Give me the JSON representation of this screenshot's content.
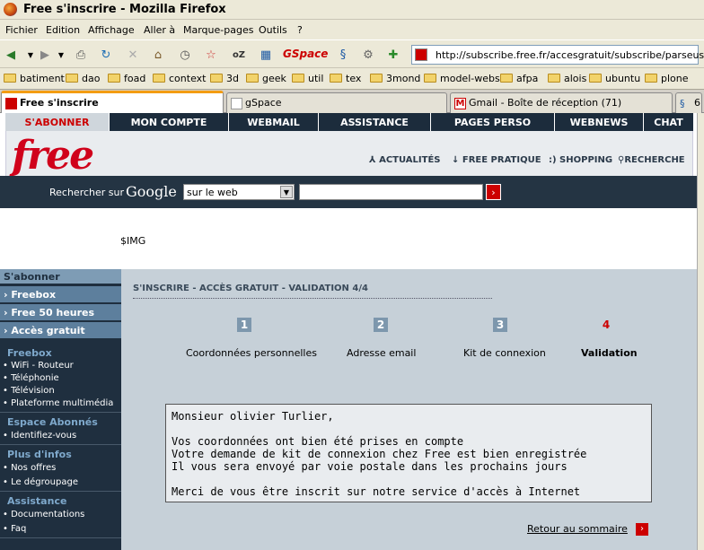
{
  "window": {
    "title": "Free s'inscrire - Mozilla Firefox"
  },
  "menu": [
    "Fichier",
    "Edition",
    "Affichage",
    "Aller à",
    "Marque-pages",
    "Outils",
    "?"
  ],
  "toolbar": {
    "gspace_label": "GSpace",
    "url": "http://subscribe.free.fr/accesgratuit/subscribe/parseuser.pl"
  },
  "bookmarks": [
    "batiment",
    "dao",
    "foad",
    "context",
    "3d",
    "geek",
    "util",
    "tex",
    "3mond",
    "model-webs",
    "afpa",
    "alois",
    "ubuntu",
    "plone"
  ],
  "tabs": [
    "Free s'inscrire",
    "gSpace",
    "Gmail - Boîte de réception (71)",
    "6"
  ],
  "free_nav": [
    "S'ABONNER",
    "MON COMPTE",
    "WEBMAIL",
    "ASSISTANCE",
    "PAGES PERSO",
    "WEBNEWS",
    "CHAT"
  ],
  "free_logo": "free",
  "header_links": [
    "ACTUALITÉS",
    "FREE PRATIQUE",
    ":) SHOPPING",
    "RECHERCHE"
  ],
  "search": {
    "label": "Rechercher sur",
    "engine": "Google",
    "scope": "sur le web",
    "go": "›"
  },
  "img_placeholder": "$IMG",
  "sidebar": {
    "title": "S'abonner",
    "top_links": [
      "Freebox",
      "Free 50 heures",
      "Accès gratuit"
    ],
    "sec_freebox": "Freebox",
    "freebox_items": [
      "WiFi - Routeur",
      "Téléphonie",
      "Télévision",
      "Plateforme multimédia"
    ],
    "sec_abonnes": "Espace Abonnés",
    "abonnes_items": [
      "Identifiez-vous"
    ],
    "sec_infos": "Plus d'infos",
    "infos_items": [
      "Nos offres",
      "Le dégroupage"
    ],
    "sec_assist": "Assistance",
    "assist_items": [
      "Documentations",
      "Faq"
    ]
  },
  "content": {
    "title": "S'INSCRIRE - ACCÈS GRATUIT - VALIDATION 4/4",
    "steps": [
      {
        "num": "1",
        "label": "Coordonnées personnelles"
      },
      {
        "num": "2",
        "label": "Adresse email"
      },
      {
        "num": "3",
        "label": "Kit de connexion"
      },
      {
        "num": "4",
        "label": "Validation"
      }
    ],
    "message": {
      "greeting": "Monsieur olivier Turlier,",
      "line1": "Vos coordonnées ont bien été prises en compte",
      "line2": "Votre demande de kit de connexion chez Free est bien enregistrée",
      "line3": "Il vous sera envoyé par voie postale dans les prochains jours",
      "line4": "Merci de vous être inscrit sur notre service d'accès à Internet"
    },
    "back_link": "Retour au sommaire"
  },
  "colors": {
    "accent": "#cc0000",
    "nav_bg": "#1c2c3c",
    "content_bg": "#c6d0d8"
  }
}
